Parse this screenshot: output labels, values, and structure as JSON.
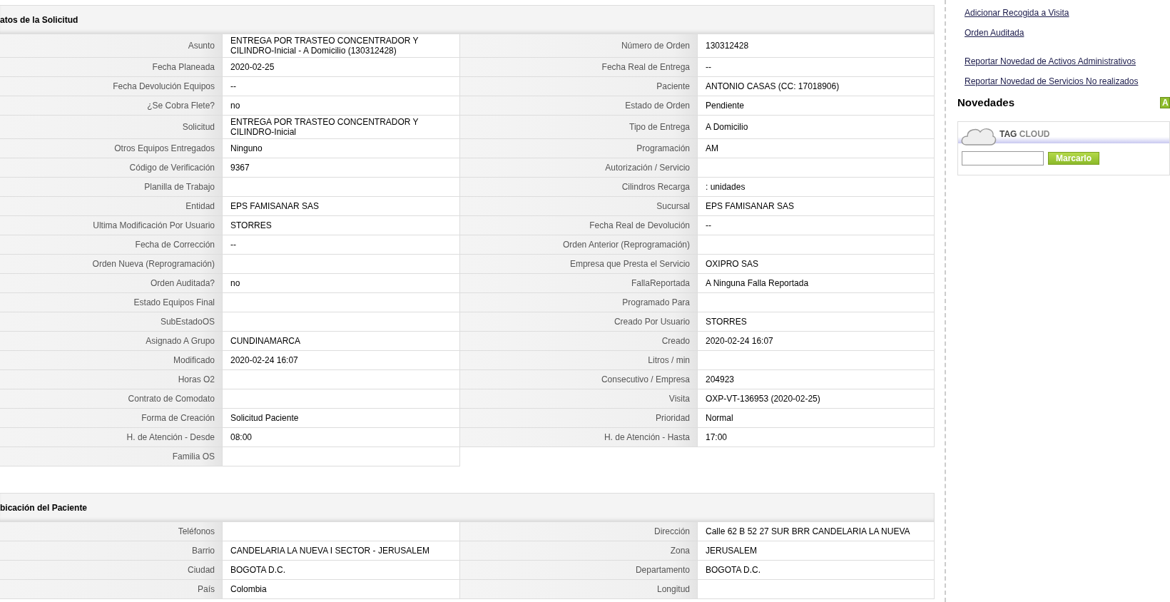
{
  "sections": [
    {
      "title": "atos de la Solicitud",
      "rows": [
        {
          "fields": [
            {
              "label": "Asunto",
              "value": "ENTREGA POR TRASTEO CONCENTRADOR Y CILINDRO-Inicial - A Domicilio (130312428)"
            },
            {
              "label": "Número de Orden",
              "value": "130312428"
            }
          ]
        },
        {
          "fields": [
            {
              "label": "Fecha Planeada",
              "value": "2020-02-25"
            },
            {
              "label": "Fecha Real de Entrega",
              "value": "--"
            }
          ]
        },
        {
          "fields": [
            {
              "label": "Fecha Devolución Equipos",
              "value": "--"
            },
            {
              "label": "Paciente",
              "value": "ANTONIO CASAS (CC: 17018906)"
            }
          ]
        },
        {
          "fields": [
            {
              "label": "¿Se Cobra Flete?",
              "value": "no"
            },
            {
              "label": "Estado de Orden",
              "value": "Pendiente"
            }
          ]
        },
        {
          "fields": [
            {
              "label": "Solicitud",
              "value": "ENTREGA POR TRASTEO CONCENTRADOR Y CILINDRO-Inicial"
            },
            {
              "label": "Tipo de Entrega",
              "value": "A Domicilio"
            }
          ]
        },
        {
          "fields": [
            {
              "label": "Otros Equipos Entregados",
              "value": "Ninguno"
            },
            {
              "label": "Programación",
              "value": "AM"
            }
          ]
        },
        {
          "fields": [
            {
              "label": "Código de Verificación",
              "value": "9367"
            },
            {
              "label": "Autorización / Servicio"
            }
          ]
        },
        {
          "fields": [
            {
              "label": "Planilla de Trabajo"
            },
            {
              "label": "Cilindros Recarga",
              "value": ": unidades"
            }
          ]
        },
        {
          "fields": [
            {
              "label": "Entidad",
              "value": "EPS FAMISANAR SAS"
            },
            {
              "label": "Sucursal",
              "value": "EPS FAMISANAR SAS"
            }
          ]
        },
        {
          "fields": [
            {
              "label": "Ultima Modificación Por Usuario",
              "value": "STORRES"
            },
            {
              "label": "Fecha Real de Devolución",
              "value": "--"
            }
          ]
        },
        {
          "fields": [
            {
              "label": "Fecha de Corrección",
              "value": "--"
            },
            {
              "label": "Orden Anterior (Reprogramación)"
            }
          ]
        },
        {
          "fields": [
            {
              "label": "Orden Nueva (Reprogramación)"
            },
            {
              "label": "Empresa que Presta el Servicio",
              "value": "OXIPRO SAS"
            }
          ]
        },
        {
          "fields": [
            {
              "label": "Orden Auditada?",
              "value": "no"
            },
            {
              "label": "FallaReportada",
              "value": "A Ninguna Falla Reportada"
            }
          ]
        },
        {
          "fields": [
            {
              "label": "Estado Equipos Final"
            },
            {
              "label": "Programado Para"
            }
          ]
        },
        {
          "fields": [
            {
              "label": "SubEstadoOS"
            },
            {
              "label": "Creado Por Usuario",
              "value": "STORRES"
            }
          ]
        },
        {
          "fields": [
            {
              "label": "Asignado A Grupo",
              "value": "CUNDINAMARCA"
            },
            {
              "label": "Creado",
              "value": "2020-02-24 16:07"
            }
          ]
        },
        {
          "fields": [
            {
              "label": "Modificado",
              "value": "2020-02-24 16:07"
            },
            {
              "label": "Litros / min"
            }
          ]
        },
        {
          "fields": [
            {
              "label": "Horas O2"
            },
            {
              "label": "Consecutivo / Empresa",
              "value": "204923"
            }
          ]
        },
        {
          "fields": [
            {
              "label": "Contrato de Comodato"
            },
            {
              "label": "Visita",
              "value": "OXP-VT-136953 (2020-02-25)"
            }
          ]
        },
        {
          "fields": [
            {
              "label": "Forma de Creación",
              "value": "Solicitud Paciente"
            },
            {
              "label": "Prioridad",
              "value": "Normal"
            }
          ]
        },
        {
          "fields": [
            {
              "label": "H. de Atención - Desde",
              "value": "08:00"
            },
            {
              "label": "H. de Atención - Hasta",
              "value": "17:00"
            }
          ]
        },
        {
          "fields": [
            {
              "label": "Familia OS"
            }
          ]
        }
      ]
    },
    {
      "title": "bicación del Paciente",
      "rows": [
        {
          "fields": [
            {
              "label": "Teléfonos"
            },
            {
              "label": "Dirección",
              "value": "Calle 62 B 52 27 SUR BRR CANDELARIA LA NUEVA"
            }
          ]
        },
        {
          "fields": [
            {
              "label": "Barrio",
              "value": "CANDELARIA LA NUEVA I SECTOR - JERUSALEM"
            },
            {
              "label": "Zona",
              "value": "JERUSALEM"
            }
          ]
        },
        {
          "fields": [
            {
              "label": "Ciudad",
              "value": "BOGOTA D.C."
            },
            {
              "label": "Departamento",
              "value": "BOGOTA D.C."
            }
          ]
        },
        {
          "fields": [
            {
              "label": "País",
              "value": "Colombia"
            },
            {
              "label": "Longitud"
            }
          ]
        }
      ]
    }
  ],
  "sidebar": {
    "link_groups": [
      [
        "Adicionar Recogida a Visita",
        "Orden Auditada"
      ],
      [
        "Reportar Novedad de Activos Administrativos",
        "Reportar Novedad de Servicios No realizados"
      ]
    ],
    "novedades": {
      "title": "Novedades",
      "button": "A"
    },
    "tag_cloud": {
      "title_1": "TAG",
      "title_2": "CLOUD",
      "button": "Marcarlo"
    }
  }
}
